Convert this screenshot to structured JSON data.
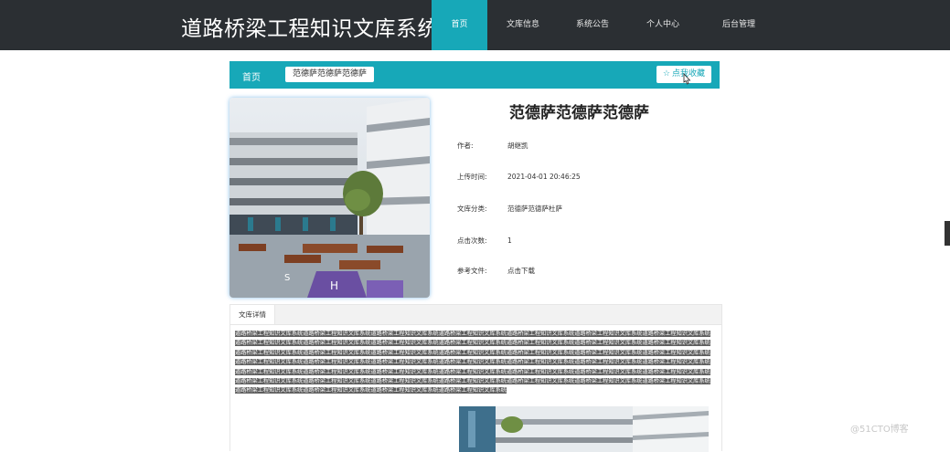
{
  "header": {
    "site_title": "道路桥梁工程知识文库系统",
    "nav": [
      "首页",
      "文库信息",
      "系统公告",
      "个人中心",
      "后台管理"
    ]
  },
  "breadcrumb": {
    "home": "首页",
    "current": "范德萨范德萨范德萨",
    "favorite_icon": "star-outline-icon",
    "favorite_label": "点我收藏"
  },
  "document": {
    "title": "范德萨范德萨范德萨",
    "author_label": "作者:",
    "author": "胡继凯",
    "upload_time_label": "上传时间:",
    "upload_time": "2021-04-01 20:46:25",
    "category_label": "文库分类:",
    "category": "范德萨范德萨杜萨",
    "clicks_label": "点击次数:",
    "clicks": "1",
    "reference_label": "参考文件:",
    "reference_link": "点击下载"
  },
  "tabs": {
    "detail": "文库详情"
  },
  "content": {
    "text": "道路桥梁工程知识文库系统道路桥梁工程知识文库系统道路桥梁工程知识文库系统道路桥梁工程知识文库系统道路桥梁工程知识文库系统道路桥梁工程知识文库系统道路桥梁工程知识文库系统道路桥梁工程知识文库系统道路桥梁工程知识文库系统道路桥梁工程知识文库系统道路桥梁工程知识文库系统道路桥梁工程知识文库系统道路桥梁工程知识文库系统道路桥梁工程知识文库系统道路桥梁工程知识文库系统道路桥梁工程知识文库系统道路桥梁工程知识文库系统道路桥梁工程知识文库系统道路桥梁工程知识文库系统道路桥梁工程知识文库系统道路桥梁工程知识文库系统道路桥梁工程知识文库系统道路桥梁工程知识文库系统道路桥梁工程知识文库系统道路桥梁工程知识文库系统道路桥梁工程知识文库系统道路桥梁工程知识文库系统道路桥梁工程知识文库系统道路桥梁工程知识文库系统道路桥梁工程知识文库系统道路桥梁工程知识文库系统道路桥梁工程知识文库系统道路桥梁工程知识文库系统道路桥梁工程知识文库系统道路桥梁工程知识文库系统道路桥梁工程知识文库系统道路桥梁工程知识文库系统道路桥梁工程知识文库系统道路桥梁工程知识文库系统道路桥梁工程知识文库系统道路桥梁工程知识文库系统道路桥梁工程知识文库系统道路桥梁工程知识文库系统道路桥梁工程知识文库系统道路桥梁工程知识文库系统道路桥梁工程知识文库系统"
  },
  "watermark": "@51CTO博客",
  "colors": {
    "accent": "#17a8b8",
    "topbar": "#2b2f33"
  }
}
